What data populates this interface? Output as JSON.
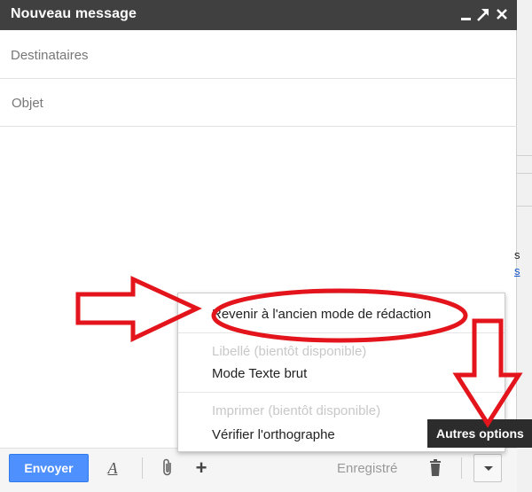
{
  "window": {
    "title": "Nouveau message",
    "controls": {
      "minimize_icon": "minimize-icon",
      "popout_icon": "popout-icon",
      "close_icon": "close-icon"
    }
  },
  "fields": {
    "recipients_placeholder": "Destinataires",
    "subject_placeholder": "Objet"
  },
  "toolbar": {
    "send_label": "Envoyer",
    "format_glyph": "A",
    "attach_icon": "paperclip-icon",
    "insert_glyph": "+",
    "saved_status": "Enregistré",
    "discard_icon": "trash-icon",
    "more_options_icon": "caret-down-icon"
  },
  "menu": {
    "items": [
      {
        "label": "Revenir à l'ancien mode de rédaction",
        "enabled": true
      },
      {
        "label": "Libellé (bientôt disponible)",
        "enabled": false
      },
      {
        "label": "Mode Texte brut",
        "enabled": true
      },
      {
        "label": "Imprimer (bientôt disponible)",
        "enabled": false
      },
      {
        "label": "Vérifier l'orthographe",
        "enabled": true
      }
    ]
  },
  "tooltip": {
    "text": "Autres options"
  },
  "background": {
    "fragments": [
      "s",
      "s"
    ]
  },
  "annotation": {
    "color": "#e3141b"
  },
  "colors": {
    "titlebar": "#404040",
    "send": "#4d90fe",
    "tooltip": "#2c2c2c"
  }
}
